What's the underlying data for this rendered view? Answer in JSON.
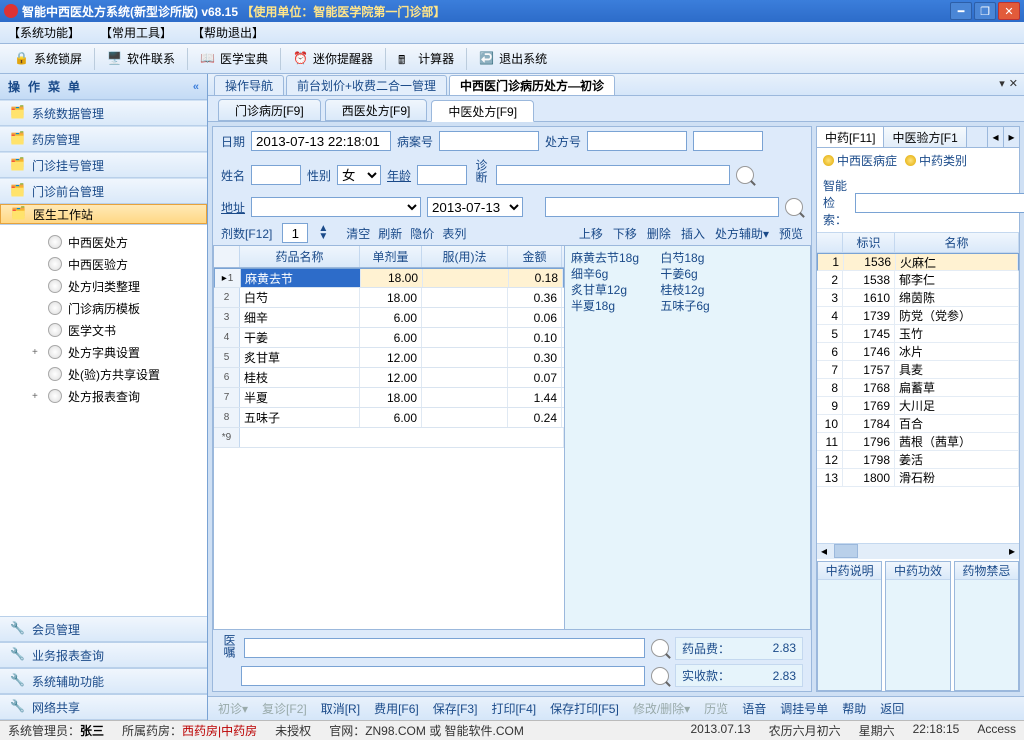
{
  "titlebar": {
    "app": "智能中西医处方系统(新型诊所版)  v68.15  ",
    "unit_label": "【使用单位：智能医学院第一门诊部】"
  },
  "menubar": [
    "【系统功能】",
    "【常用工具】",
    "【帮助退出】"
  ],
  "toolbar": [
    {
      "icon": "lock-icon",
      "label": "系统锁屏"
    },
    {
      "icon": "support-icon",
      "label": "软件联系"
    },
    {
      "icon": "book-icon",
      "label": "医学宝典"
    },
    {
      "icon": "bell-icon",
      "label": "迷你提醒器"
    },
    {
      "icon": "calc-icon",
      "label": "计算器"
    },
    {
      "icon": "exit-icon",
      "label": "退出系统"
    }
  ],
  "sidebar": {
    "header": "操作菜单",
    "top": [
      "系统数据管理",
      "药房管理",
      "门诊挂号管理",
      "门诊前台管理",
      "医生工作站"
    ],
    "tree": [
      {
        "label": "中西医处方"
      },
      {
        "label": "中西医验方"
      },
      {
        "label": "处方归类整理"
      },
      {
        "label": "门诊病历模板"
      },
      {
        "label": "医学文书"
      },
      {
        "label": "处方字典设置",
        "exp": "+"
      },
      {
        "label": "处(验)方共享设置"
      },
      {
        "label": "处方报表查询",
        "exp": "+"
      }
    ],
    "bottom": [
      "会员管理",
      "业务报表查询",
      "系统辅助功能",
      "网络共享"
    ]
  },
  "tabs": [
    "操作导航",
    "前台划价+收费二合一管理",
    "中西医门诊病历处方—初诊"
  ],
  "subtabs": [
    "门诊病历[F9]",
    "西医处方[F9]",
    "中医处方[F9]"
  ],
  "form": {
    "date_label": "日期",
    "date_value": "2013-07-13 22:18:01",
    "caseno_label": "病案号",
    "caseno_value": "",
    "rxno_label": "处方号",
    "rxno_value": "",
    "name_label": "姓名",
    "name_value": "",
    "sex_label": "性别",
    "sex_value": "女",
    "age_label": "年龄",
    "age_value": "",
    "addr_label": "地址",
    "addr_value": "",
    "date2_value": "2013-07-13",
    "diag_label": "诊断",
    "diag_value": ""
  },
  "ctrl": {
    "dose_label": "剂数[F12]",
    "dose_value": "1",
    "links": [
      "清空",
      "刷新",
      "隐价",
      "表列"
    ],
    "right": [
      "上移",
      "下移",
      "删除",
      "插入",
      "处方辅助▾",
      "预览"
    ]
  },
  "grid": {
    "headers": [
      "药品名称",
      "单剂量",
      "服(用)法",
      "金额"
    ],
    "rows": [
      {
        "n": 1,
        "name": "麻黄去节",
        "dose": "18.00",
        "usage": "",
        "amt": "0.18",
        "cur": true
      },
      {
        "n": 2,
        "name": "白芍",
        "dose": "18.00",
        "usage": "",
        "amt": "0.36"
      },
      {
        "n": 3,
        "name": "细辛",
        "dose": "6.00",
        "usage": "",
        "amt": "0.06"
      },
      {
        "n": 4,
        "name": "干姜",
        "dose": "6.00",
        "usage": "",
        "amt": "0.10"
      },
      {
        "n": 5,
        "name": "炙甘草",
        "dose": "12.00",
        "usage": "",
        "amt": "0.30"
      },
      {
        "n": 6,
        "name": "桂枝",
        "dose": "12.00",
        "usage": "",
        "amt": "0.07"
      },
      {
        "n": 7,
        "name": "半夏",
        "dose": "18.00",
        "usage": "",
        "amt": "1.44"
      },
      {
        "n": 8,
        "name": "五味子",
        "dose": "6.00",
        "usage": "",
        "amt": "0.24"
      }
    ],
    "star": "*9"
  },
  "herbs": {
    "col1": [
      "麻黄去节18g",
      "细辛6g",
      "炙甘草12g",
      "半夏18g"
    ],
    "col2": [
      "白芍18g",
      "干姜6g",
      "桂枝12g",
      "五味子6g"
    ]
  },
  "advice": {
    "label": "医嘱",
    "value": ""
  },
  "fees": {
    "rx_label": "药品费：",
    "rx_value": "2.83",
    "pay_label": "实收款：",
    "pay_value": "2.83"
  },
  "ref": {
    "tabs": [
      "中药[F11]",
      "中医验方[F1"
    ],
    "btn1": "中西医病症",
    "btn2": "中药类别",
    "search_label": "智能检索：",
    "search_value": "",
    "headers": [
      "",
      "标识",
      "名称"
    ],
    "rows": [
      {
        "n": 1,
        "id": "1536",
        "name": "火麻仁",
        "sel": true
      },
      {
        "n": 2,
        "id": "1538",
        "name": "郁李仁"
      },
      {
        "n": 3,
        "id": "1610",
        "name": "绵茵陈"
      },
      {
        "n": 4,
        "id": "1739",
        "name": "防党（党参）"
      },
      {
        "n": 5,
        "id": "1745",
        "name": "玉竹"
      },
      {
        "n": 6,
        "id": "1746",
        "name": "冰片"
      },
      {
        "n": 7,
        "id": "1757",
        "name": "具麦"
      },
      {
        "n": 8,
        "id": "1768",
        "name": "扁蓄草"
      },
      {
        "n": 9,
        "id": "1769",
        "name": "大川足"
      },
      {
        "n": 10,
        "id": "1784",
        "name": "百合"
      },
      {
        "n": 11,
        "id": "1796",
        "name": "茜根（茜草）"
      },
      {
        "n": 12,
        "id": "1798",
        "name": "姜活"
      },
      {
        "n": 13,
        "id": "1800",
        "name": "滑石粉"
      }
    ],
    "infocols": [
      "中药说明",
      "中药功效",
      "药物禁忌"
    ]
  },
  "fnbar": [
    {
      "t": "初诊▾",
      "dim": true
    },
    {
      "t": "复诊[F2]",
      "dim": true
    },
    {
      "t": "取消[R]"
    },
    {
      "t": "费用[F6]"
    },
    {
      "t": "保存[F3]"
    },
    {
      "t": "打印[F4]"
    },
    {
      "t": "保存打印[F5]"
    },
    {
      "t": "修改/删除▾",
      "dim": true
    },
    {
      "t": "历览",
      "dim": true
    },
    {
      "t": "语音"
    },
    {
      "t": "调挂号单"
    },
    {
      "t": "帮助"
    },
    {
      "t": "返回"
    }
  ],
  "status": {
    "admin_label": "系统管理员：",
    "admin": "张三",
    "pharm_label": "所属药房：",
    "pharm": "西药房|中药房",
    "auth": "未授权",
    "site": "官网：ZN98.COM 或 智能软件.COM",
    "date": "2013.07.13",
    "lunar": "农历六月初六",
    "weekday": "星期六",
    "time": "22:18:15",
    "access": "Access"
  }
}
